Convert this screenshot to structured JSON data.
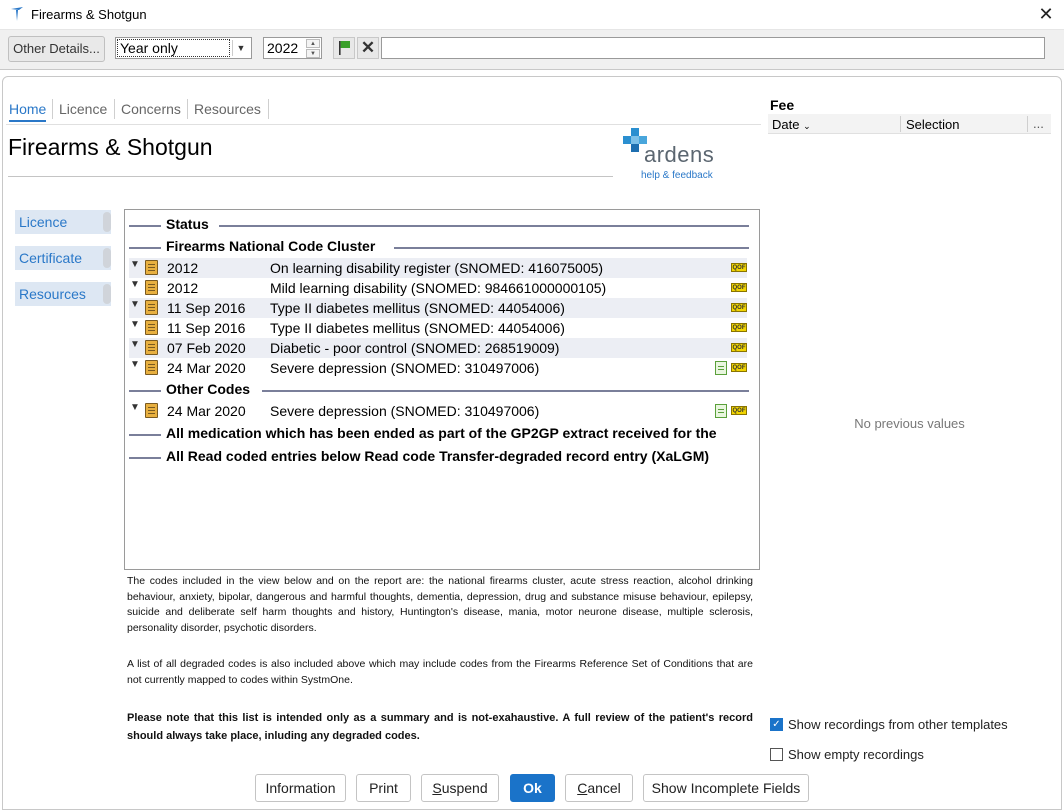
{
  "window": {
    "title": "Firearms & Shotgun"
  },
  "toolbar": {
    "other_details_label": "Other Details...",
    "date_mode_selected": "Year only",
    "year_value": "2022",
    "free_text_value": ""
  },
  "tabs": [
    {
      "label": "Home",
      "active": true
    },
    {
      "label": "Licence",
      "active": false
    },
    {
      "label": "Concerns",
      "active": false
    },
    {
      "label": "Resources",
      "active": false
    }
  ],
  "page": {
    "title": "Firearms & Shotgun",
    "logo_text": "ardens",
    "logo_link": "help & feedback"
  },
  "sidenav": [
    {
      "label": "Licence"
    },
    {
      "label": "Certificate"
    },
    {
      "label": "Resources"
    }
  ],
  "main": {
    "status_header": "Status",
    "cluster_header": "Firearms National Code Cluster",
    "cluster_rows": [
      {
        "date": "2012",
        "desc": "On learning disability register (SNOMED: 416075005)",
        "badge": "QOF",
        "note": false
      },
      {
        "date": "2012",
        "desc": "Mild learning disability (SNOMED: 984661000000105)",
        "badge": "QOF",
        "note": false
      },
      {
        "date": "11 Sep 2016",
        "desc": "Type II diabetes mellitus (SNOMED: 44054006)",
        "badge": "QOF",
        "note": false
      },
      {
        "date": "11 Sep 2016",
        "desc": "Type II diabetes mellitus (SNOMED: 44054006)",
        "badge": "QOF",
        "note": false
      },
      {
        "date": "07 Feb 2020",
        "desc": "Diabetic - poor control (SNOMED: 268519009)",
        "badge": "QOF",
        "note": false
      },
      {
        "date": "24 Mar 2020",
        "desc": "Severe depression (SNOMED: 310497006)",
        "badge": "QOF",
        "note": true
      }
    ],
    "other_header": "Other Codes",
    "other_rows": [
      {
        "date": "24 Mar 2020",
        "desc": "Severe depression (SNOMED: 310497006)",
        "badge": "QOF",
        "note": true
      }
    ],
    "ended_med_header": "All medication which has been ended as part of the GP2GP extract received for the",
    "read_coded_header": "All Read coded entries below Read code Transfer-degraded record entry (XaLGM)"
  },
  "info": {
    "para1": "The codes included in the view below and on the report are: the national firearms cluster, acute stress reaction, alcohol drinking behaviour, anxiety, bipolar, dangerous and harmful thoughts, dementia, depression, drug and substance misuse behaviour, epilepsy, suicide and deliberate self harm thoughts and history, Huntington's disease, mania, motor neurone disease, multiple sclerosis, personality disorder, psychotic disorders.",
    "para2": "A list of all degraded codes is also included above which may include codes from the Firearms Reference Set of Conditions that are not currently mapped to codes within SystmOne.",
    "para3": "Please note that this list is intended only as a summary and is not-exahaustive. A full review of the patient's record should always take place, inluding any degraded codes."
  },
  "fee": {
    "title": "Fee",
    "col_date": "Date",
    "col_selection": "Selection",
    "col_more": "...",
    "empty_text": "No previous values"
  },
  "options": {
    "show_other_templates": "Show recordings from other templates",
    "show_other_templates_checked": true,
    "show_empty": "Show empty recordings",
    "show_empty_checked": false
  },
  "buttons": {
    "information": "Information",
    "print": "Print",
    "suspend": "Suspend",
    "ok": "Ok",
    "cancel": "Cancel",
    "show_incomplete": "Show Incomplete Fields"
  },
  "colors": {
    "accent": "#1a73c9",
    "link": "#2a78c8",
    "qof": "#f1d400"
  }
}
